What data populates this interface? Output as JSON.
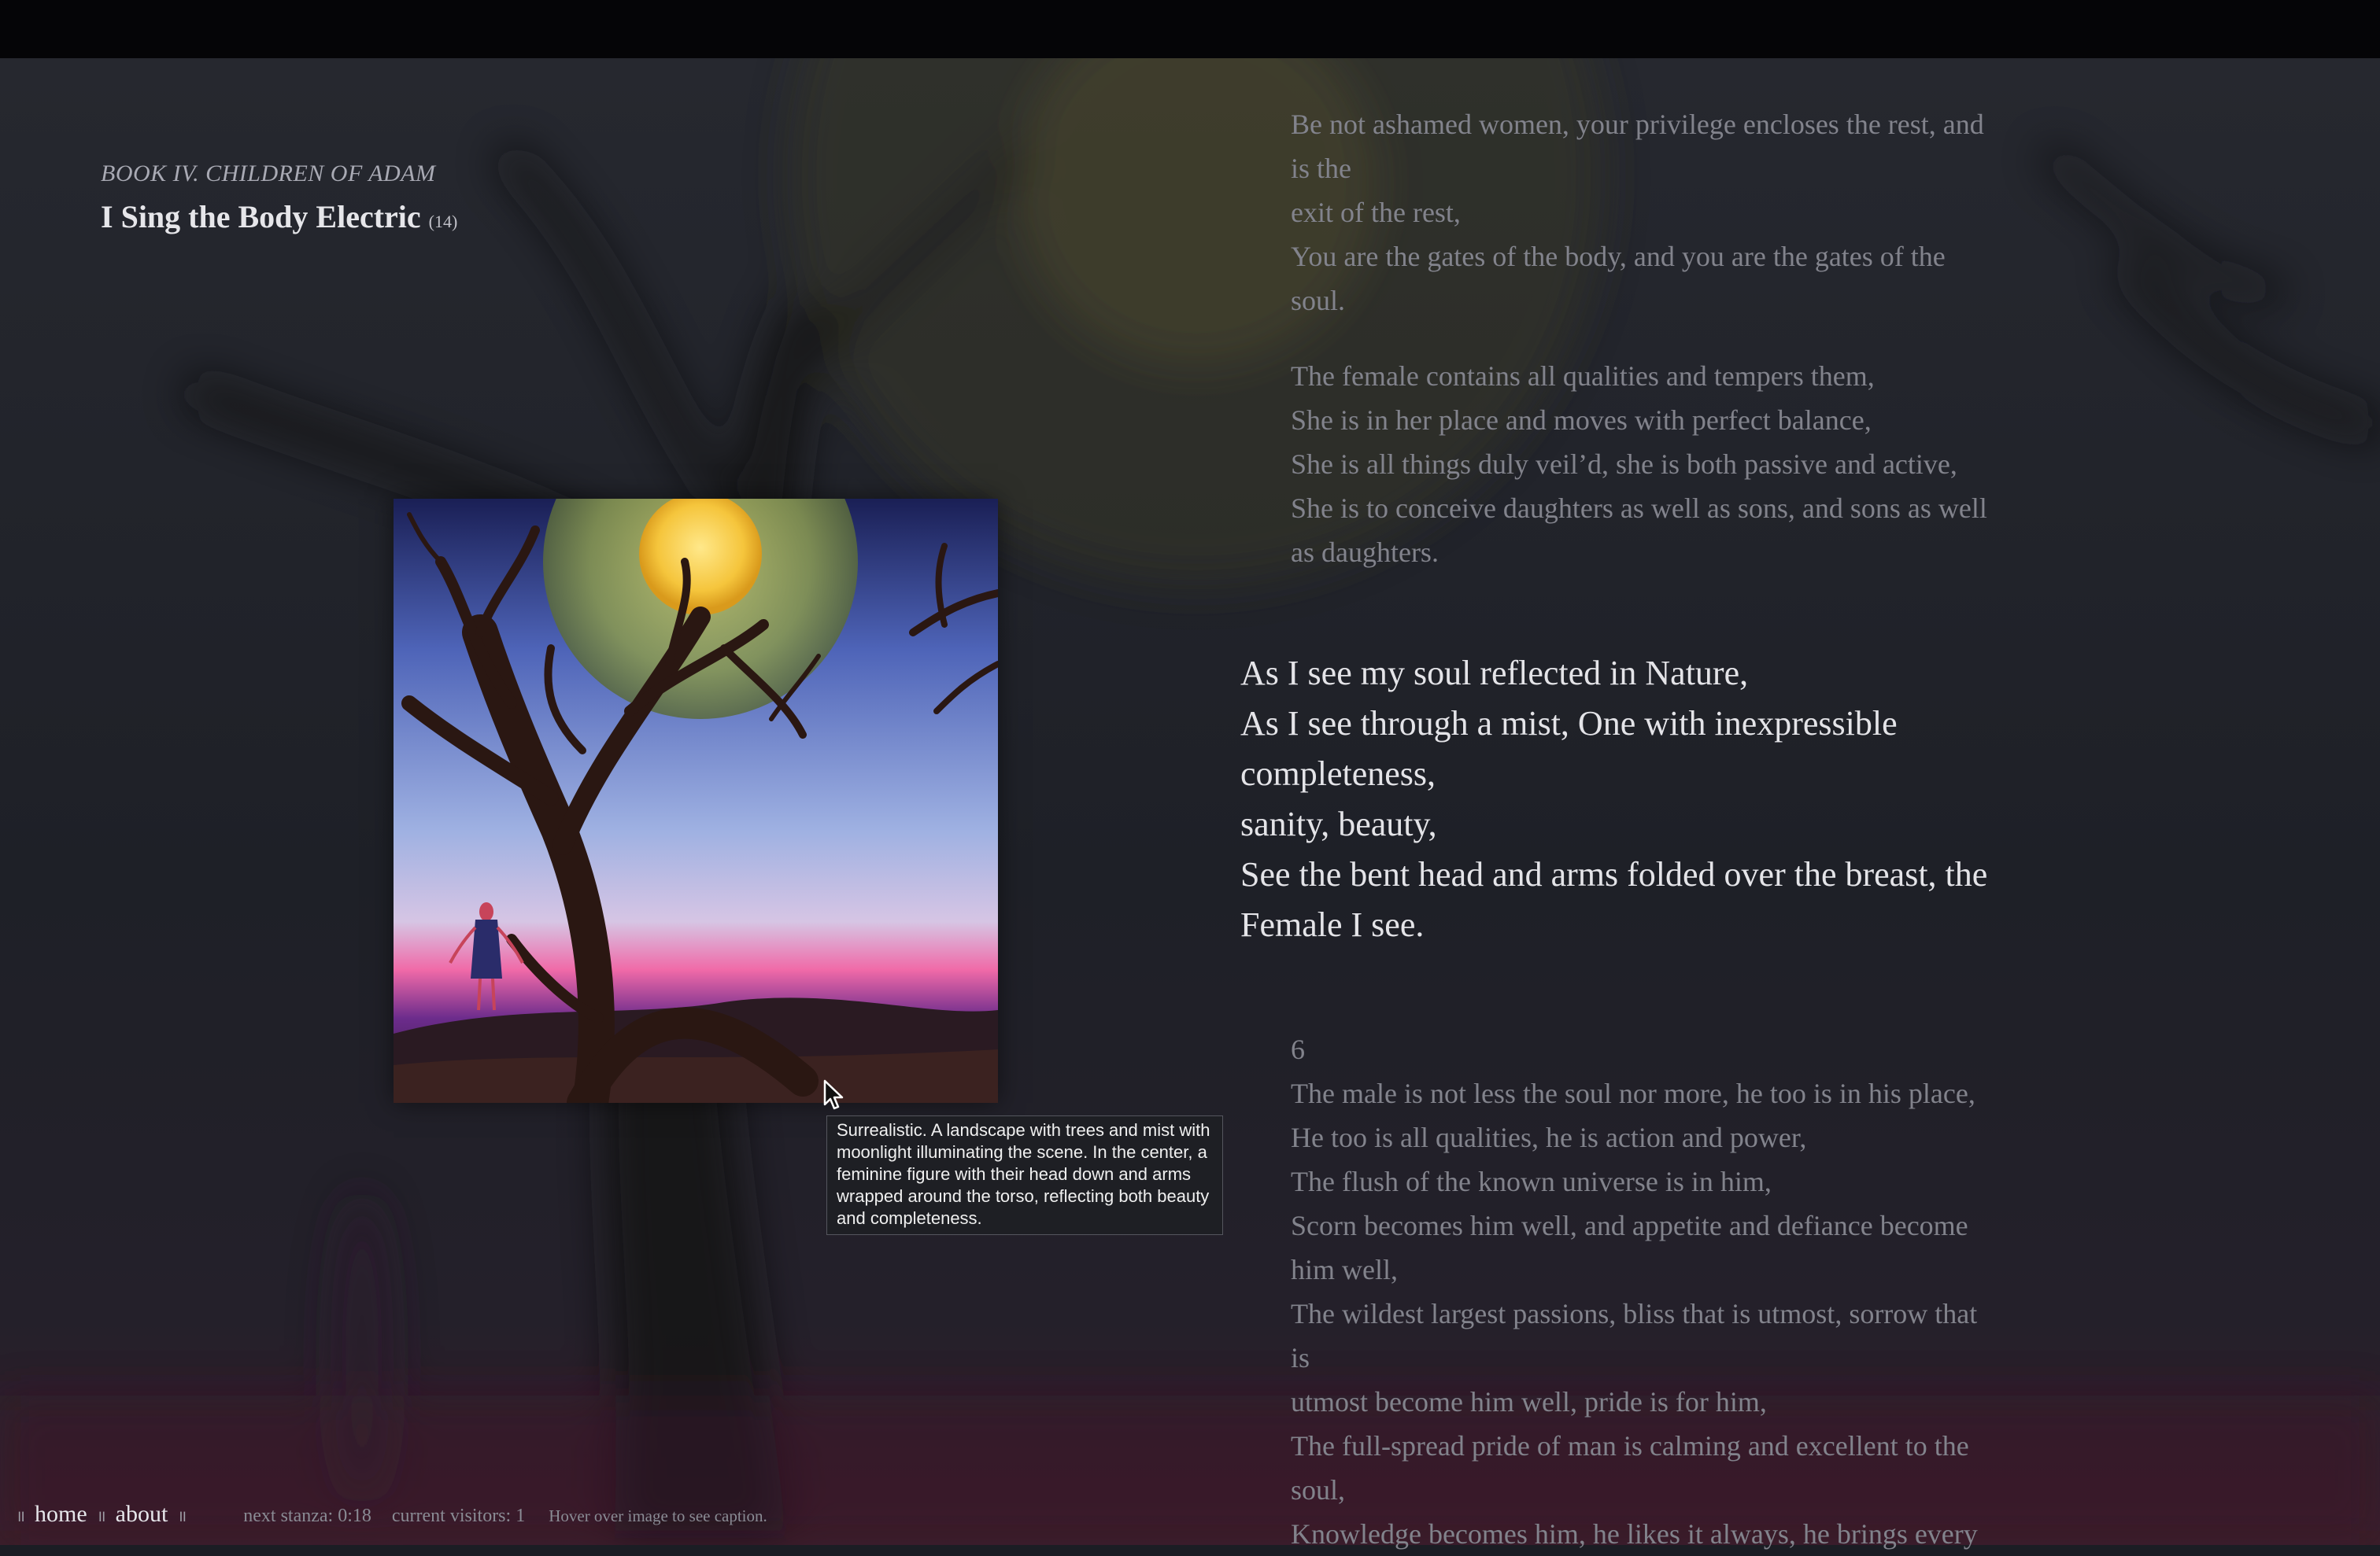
{
  "colors": {
    "background": "#1b1d24",
    "topbar": "#050507",
    "stanza_dim": "#82838c",
    "stanza_active": "#e4e4e8",
    "tooltip_bg": "#1e1f24"
  },
  "header": {
    "book": "BOOK IV. CHILDREN OF ADAM",
    "title": "I Sing the Body Electric",
    "title_number": "(14)"
  },
  "image": {
    "alt_icon": "surreal-landscape-image"
  },
  "tooltip": {
    "text": "Surrealistic. A landscape with trees and mist with moonlight illuminating the scene. In the center, a feminine figure with their head down and arms wrapped around the torso, reflecting both beauty and completeness."
  },
  "poem": {
    "stanza_a": [
      "Be not ashamed women, your privilege encloses the rest, and",
      "is the",
      "exit of the rest,",
      "You are the gates of the body, and you are the gates of the",
      "soul."
    ],
    "stanza_b": [
      "The female contains all qualities and tempers them,",
      "She is in her place and moves with perfect balance,",
      "She is all things duly veil’d, she is both passive and active,",
      "She is to conceive daughters as well as sons, and sons as well",
      "as daughters."
    ],
    "stanza_current": [
      "As I see my soul reflected in Nature,",
      "As I see through a mist, One with inexpressible",
      "completeness,",
      "sanity, beauty,",
      "See the bent head and arms folded over the breast, the",
      "Female I see."
    ],
    "section_number": "6",
    "stanza_d": [
      "The male is not less the soul nor more, he too is in his place,",
      "He too is all qualities, he is action and power,",
      "The flush of the known universe is in him,",
      "Scorn becomes him well, and appetite and defiance become",
      "him well,",
      "The wildest largest passions, bliss that is utmost, sorrow that",
      "is",
      "utmost become him well, pride is for him,",
      "The full-spread pride of man is calming and excellent to the",
      "soul,",
      "Knowledge becomes him, he likes it always, he brings every"
    ]
  },
  "footer": {
    "sep": "॥",
    "home": "home",
    "about": "about",
    "next_stanza": "next stanza: 0:18",
    "visitors": "current visitors: 1",
    "hint": "Hover over image to see caption."
  }
}
